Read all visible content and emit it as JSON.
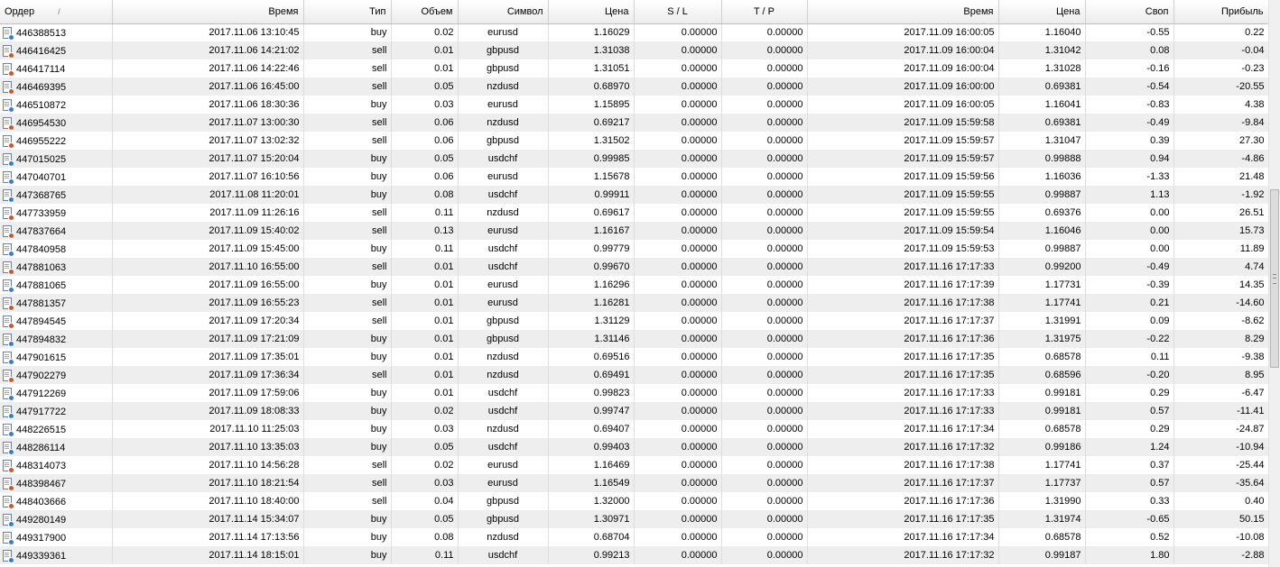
{
  "columns": {
    "order": "Ордер",
    "open_time": "Время",
    "type": "Тип",
    "volume": "Объем",
    "symbol": "Символ",
    "open_price": "Цена",
    "sl": "S / L",
    "tp": "T / P",
    "close_time": "Время",
    "close_price": "Цена",
    "swap": "Своп",
    "profit": "Прибыль"
  },
  "sort": {
    "column": "order",
    "indicator": "/"
  },
  "colors": {
    "buy_icon": "#2f7fd8",
    "sell_icon": "#d9531e",
    "alt_row": "#eeeeee"
  },
  "rows": [
    {
      "order": "446388513",
      "open_time": "2017.11.06 13:10:45",
      "type": "buy",
      "volume": "0.02",
      "symbol": "eurusd",
      "open_price": "1.16029",
      "sl": "0.00000",
      "tp": "0.00000",
      "close_time": "2017.11.09 16:00:05",
      "close_price": "1.16040",
      "swap": "-0.55",
      "profit": "0.22"
    },
    {
      "order": "446416425",
      "open_time": "2017.11.06 14:21:02",
      "type": "sell",
      "volume": "0.01",
      "symbol": "gbpusd",
      "open_price": "1.31038",
      "sl": "0.00000",
      "tp": "0.00000",
      "close_time": "2017.11.09 16:00:04",
      "close_price": "1.31042",
      "swap": "0.08",
      "profit": "-0.04"
    },
    {
      "order": "446417114",
      "open_time": "2017.11.06 14:22:46",
      "type": "sell",
      "volume": "0.01",
      "symbol": "gbpusd",
      "open_price": "1.31051",
      "sl": "0.00000",
      "tp": "0.00000",
      "close_time": "2017.11.09 16:00:04",
      "close_price": "1.31028",
      "swap": "-0.16",
      "profit": "-0.23"
    },
    {
      "order": "446469395",
      "open_time": "2017.11.06 16:45:00",
      "type": "sell",
      "volume": "0.05",
      "symbol": "nzdusd",
      "open_price": "0.68970",
      "sl": "0.00000",
      "tp": "0.00000",
      "close_time": "2017.11.09 16:00:00",
      "close_price": "0.69381",
      "swap": "-0.54",
      "profit": "-20.55"
    },
    {
      "order": "446510872",
      "open_time": "2017.11.06 18:30:36",
      "type": "buy",
      "volume": "0.03",
      "symbol": "eurusd",
      "open_price": "1.15895",
      "sl": "0.00000",
      "tp": "0.00000",
      "close_time": "2017.11.09 16:00:05",
      "close_price": "1.16041",
      "swap": "-0.83",
      "profit": "4.38"
    },
    {
      "order": "446954530",
      "open_time": "2017.11.07 13:00:30",
      "type": "sell",
      "volume": "0.06",
      "symbol": "nzdusd",
      "open_price": "0.69217",
      "sl": "0.00000",
      "tp": "0.00000",
      "close_time": "2017.11.09 15:59:58",
      "close_price": "0.69381",
      "swap": "-0.49",
      "profit": "-9.84"
    },
    {
      "order": "446955222",
      "open_time": "2017.11.07 13:02:32",
      "type": "sell",
      "volume": "0.06",
      "symbol": "gbpusd",
      "open_price": "1.31502",
      "sl": "0.00000",
      "tp": "0.00000",
      "close_time": "2017.11.09 15:59:57",
      "close_price": "1.31047",
      "swap": "0.39",
      "profit": "27.30"
    },
    {
      "order": "447015025",
      "open_time": "2017.11.07 15:20:04",
      "type": "buy",
      "volume": "0.05",
      "symbol": "usdchf",
      "open_price": "0.99985",
      "sl": "0.00000",
      "tp": "0.00000",
      "close_time": "2017.11.09 15:59:57",
      "close_price": "0.99888",
      "swap": "0.94",
      "profit": "-4.86"
    },
    {
      "order": "447040701",
      "open_time": "2017.11.07 16:10:56",
      "type": "buy",
      "volume": "0.06",
      "symbol": "eurusd",
      "open_price": "1.15678",
      "sl": "0.00000",
      "tp": "0.00000",
      "close_time": "2017.11.09 15:59:56",
      "close_price": "1.16036",
      "swap": "-1.33",
      "profit": "21.48"
    },
    {
      "order": "447368765",
      "open_time": "2017.11.08 11:20:01",
      "type": "buy",
      "volume": "0.08",
      "symbol": "usdchf",
      "open_price": "0.99911",
      "sl": "0.00000",
      "tp": "0.00000",
      "close_time": "2017.11.09 15:59:55",
      "close_price": "0.99887",
      "swap": "1.13",
      "profit": "-1.92"
    },
    {
      "order": "447733959",
      "open_time": "2017.11.09 11:26:16",
      "type": "sell",
      "volume": "0.11",
      "symbol": "nzdusd",
      "open_price": "0.69617",
      "sl": "0.00000",
      "tp": "0.00000",
      "close_time": "2017.11.09 15:59:55",
      "close_price": "0.69376",
      "swap": "0.00",
      "profit": "26.51"
    },
    {
      "order": "447837664",
      "open_time": "2017.11.09 15:40:02",
      "type": "sell",
      "volume": "0.13",
      "symbol": "eurusd",
      "open_price": "1.16167",
      "sl": "0.00000",
      "tp": "0.00000",
      "close_time": "2017.11.09 15:59:54",
      "close_price": "1.16046",
      "swap": "0.00",
      "profit": "15.73"
    },
    {
      "order": "447840958",
      "open_time": "2017.11.09 15:45:00",
      "type": "buy",
      "volume": "0.11",
      "symbol": "usdchf",
      "open_price": "0.99779",
      "sl": "0.00000",
      "tp": "0.00000",
      "close_time": "2017.11.09 15:59:53",
      "close_price": "0.99887",
      "swap": "0.00",
      "profit": "11.89"
    },
    {
      "order": "447881063",
      "open_time": "2017.11.10 16:55:00",
      "type": "sell",
      "volume": "0.01",
      "symbol": "usdchf",
      "open_price": "0.99670",
      "sl": "0.00000",
      "tp": "0.00000",
      "close_time": "2017.11.16 17:17:33",
      "close_price": "0.99200",
      "swap": "-0.49",
      "profit": "4.74"
    },
    {
      "order": "447881065",
      "open_time": "2017.11.09 16:55:00",
      "type": "buy",
      "volume": "0.01",
      "symbol": "eurusd",
      "open_price": "1.16296",
      "sl": "0.00000",
      "tp": "0.00000",
      "close_time": "2017.11.16 17:17:39",
      "close_price": "1.17731",
      "swap": "-0.39",
      "profit": "14.35"
    },
    {
      "order": "447881357",
      "open_time": "2017.11.09 16:55:23",
      "type": "sell",
      "volume": "0.01",
      "symbol": "eurusd",
      "open_price": "1.16281",
      "sl": "0.00000",
      "tp": "0.00000",
      "close_time": "2017.11.16 17:17:38",
      "close_price": "1.17741",
      "swap": "0.21",
      "profit": "-14.60"
    },
    {
      "order": "447894545",
      "open_time": "2017.11.09 17:20:34",
      "type": "sell",
      "volume": "0.01",
      "symbol": "gbpusd",
      "open_price": "1.31129",
      "sl": "0.00000",
      "tp": "0.00000",
      "close_time": "2017.11.16 17:17:37",
      "close_price": "1.31991",
      "swap": "0.09",
      "profit": "-8.62"
    },
    {
      "order": "447894832",
      "open_time": "2017.11.09 17:21:09",
      "type": "buy",
      "volume": "0.01",
      "symbol": "gbpusd",
      "open_price": "1.31146",
      "sl": "0.00000",
      "tp": "0.00000",
      "close_time": "2017.11.16 17:17:36",
      "close_price": "1.31975",
      "swap": "-0.22",
      "profit": "8.29"
    },
    {
      "order": "447901615",
      "open_time": "2017.11.09 17:35:01",
      "type": "buy",
      "volume": "0.01",
      "symbol": "nzdusd",
      "open_price": "0.69516",
      "sl": "0.00000",
      "tp": "0.00000",
      "close_time": "2017.11.16 17:17:35",
      "close_price": "0.68578",
      "swap": "0.11",
      "profit": "-9.38"
    },
    {
      "order": "447902279",
      "open_time": "2017.11.09 17:36:34",
      "type": "sell",
      "volume": "0.01",
      "symbol": "nzdusd",
      "open_price": "0.69491",
      "sl": "0.00000",
      "tp": "0.00000",
      "close_time": "2017.11.16 17:17:35",
      "close_price": "0.68596",
      "swap": "-0.20",
      "profit": "8.95"
    },
    {
      "order": "447912269",
      "open_time": "2017.11.09 17:59:06",
      "type": "buy",
      "volume": "0.01",
      "symbol": "usdchf",
      "open_price": "0.99823",
      "sl": "0.00000",
      "tp": "0.00000",
      "close_time": "2017.11.16 17:17:33",
      "close_price": "0.99181",
      "swap": "0.29",
      "profit": "-6.47"
    },
    {
      "order": "447917722",
      "open_time": "2017.11.09 18:08:33",
      "type": "buy",
      "volume": "0.02",
      "symbol": "usdchf",
      "open_price": "0.99747",
      "sl": "0.00000",
      "tp": "0.00000",
      "close_time": "2017.11.16 17:17:33",
      "close_price": "0.99181",
      "swap": "0.57",
      "profit": "-11.41"
    },
    {
      "order": "448226515",
      "open_time": "2017.11.10 11:25:03",
      "type": "buy",
      "volume": "0.03",
      "symbol": "nzdusd",
      "open_price": "0.69407",
      "sl": "0.00000",
      "tp": "0.00000",
      "close_time": "2017.11.16 17:17:34",
      "close_price": "0.68578",
      "swap": "0.29",
      "profit": "-24.87"
    },
    {
      "order": "448286114",
      "open_time": "2017.11.10 13:35:03",
      "type": "buy",
      "volume": "0.05",
      "symbol": "usdchf",
      "open_price": "0.99403",
      "sl": "0.00000",
      "tp": "0.00000",
      "close_time": "2017.11.16 17:17:32",
      "close_price": "0.99186",
      "swap": "1.24",
      "profit": "-10.94"
    },
    {
      "order": "448314073",
      "open_time": "2017.11.10 14:56:28",
      "type": "sell",
      "volume": "0.02",
      "symbol": "eurusd",
      "open_price": "1.16469",
      "sl": "0.00000",
      "tp": "0.00000",
      "close_time": "2017.11.16 17:17:38",
      "close_price": "1.17741",
      "swap": "0.37",
      "profit": "-25.44"
    },
    {
      "order": "448398467",
      "open_time": "2017.11.10 18:21:54",
      "type": "sell",
      "volume": "0.03",
      "symbol": "eurusd",
      "open_price": "1.16549",
      "sl": "0.00000",
      "tp": "0.00000",
      "close_time": "2017.11.16 17:17:37",
      "close_price": "1.17737",
      "swap": "0.57",
      "profit": "-35.64"
    },
    {
      "order": "448403666",
      "open_time": "2017.11.10 18:40:00",
      "type": "sell",
      "volume": "0.04",
      "symbol": "gbpusd",
      "open_price": "1.32000",
      "sl": "0.00000",
      "tp": "0.00000",
      "close_time": "2017.11.16 17:17:36",
      "close_price": "1.31990",
      "swap": "0.33",
      "profit": "0.40"
    },
    {
      "order": "449280149",
      "open_time": "2017.11.14 15:34:07",
      "type": "buy",
      "volume": "0.05",
      "symbol": "gbpusd",
      "open_price": "1.30971",
      "sl": "0.00000",
      "tp": "0.00000",
      "close_time": "2017.11.16 17:17:35",
      "close_price": "1.31974",
      "swap": "-0.65",
      "profit": "50.15"
    },
    {
      "order": "449317900",
      "open_time": "2017.11.14 17:13:56",
      "type": "buy",
      "volume": "0.08",
      "symbol": "nzdusd",
      "open_price": "0.68704",
      "sl": "0.00000",
      "tp": "0.00000",
      "close_time": "2017.11.16 17:17:34",
      "close_price": "0.68578",
      "swap": "0.52",
      "profit": "-10.08"
    },
    {
      "order": "449339361",
      "open_time": "2017.11.14 18:15:01",
      "type": "buy",
      "volume": "0.11",
      "symbol": "usdchf",
      "open_price": "0.99213",
      "sl": "0.00000",
      "tp": "0.00000",
      "close_time": "2017.11.16 17:17:32",
      "close_price": "0.99187",
      "swap": "1.80",
      "profit": "-2.88"
    }
  ]
}
